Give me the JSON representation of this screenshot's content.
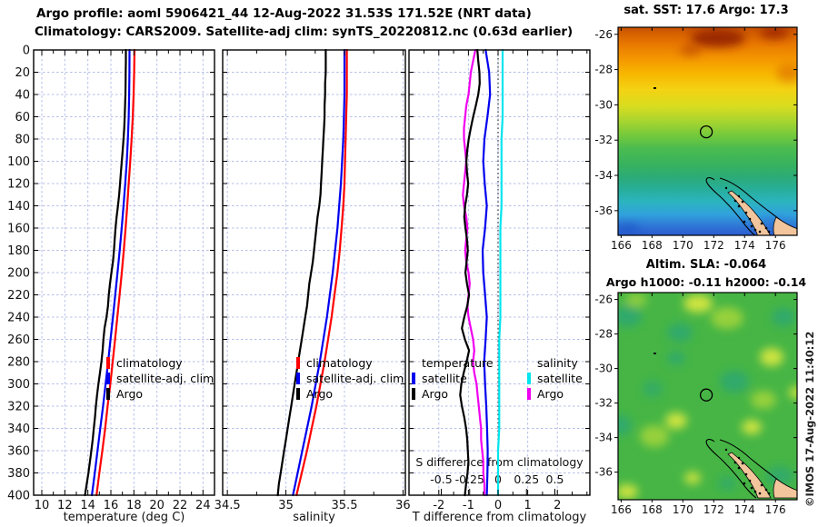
{
  "header": {
    "line1": "Argo profile: aoml 5906421_44 12-Aug-2022 31.53S 171.52E (NRT data)",
    "line2": "Climatology: CARS2009. Satellite-adj clim: synTS_20220812.nc (0.63d earlier)"
  },
  "watermark": "©IMOS 17-Aug-2022 11:40:12",
  "colors": {
    "climatology": "#ff0000",
    "satellite_adj_clim": "#0000ee",
    "argo": "#000000",
    "satellite_salinity": "#00e5ee",
    "argo_salinity": "#f000f0",
    "grid": "#b7bfe8",
    "land": "#f2c59c"
  },
  "legends": {
    "profile": [
      {
        "label": "climatology",
        "color": "#ff0000"
      },
      {
        "label": "satellite-adj. clim",
        "color": "#0000ee"
      },
      {
        "label": "Argo",
        "color": "#000000"
      }
    ],
    "difference": {
      "temperature": {
        "header": "temperature",
        "items": [
          {
            "label": "satellite",
            "color": "#0000ee"
          },
          {
            "label": "Argo",
            "color": "#000000"
          }
        ]
      },
      "salinity": {
        "header": "salinity",
        "items": [
          {
            "label": "satellite",
            "color": "#00e5ee"
          },
          {
            "label": "Argo",
            "color": "#f000f0"
          }
        ]
      }
    }
  },
  "chart_data": [
    {
      "id": "temperature-profile",
      "type": "line",
      "xlabel": "temperature (deg C)",
      "ylabel": "",
      "xlim": [
        9.29,
        25.0
      ],
      "ylim": [
        0,
        400
      ],
      "xticks": [
        10,
        12,
        14,
        16,
        18,
        20,
        22,
        24
      ],
      "xminor": 1,
      "ytick_step": 20,
      "grid": true,
      "series": [
        {
          "name": "climatology",
          "color": "#ff0000",
          "depth_step": 20,
          "values": [
            18.05,
            18.02,
            17.97,
            17.9,
            17.8,
            17.68,
            17.55,
            17.42,
            17.28,
            17.12,
            16.95,
            16.76,
            16.56,
            16.36,
            16.16,
            15.95,
            15.72,
            15.5,
            15.26,
            15.0,
            14.75
          ]
        },
        {
          "name": "satellite-adj. clim",
          "color": "#0000ee",
          "depth_step": 20,
          "values": [
            17.62,
            17.61,
            17.59,
            17.55,
            17.48,
            17.38,
            17.25,
            17.1,
            16.94,
            16.77,
            16.58,
            16.38,
            16.18,
            15.97,
            15.76,
            15.54,
            15.32,
            15.08,
            14.84,
            14.6,
            14.35
          ]
        },
        {
          "name": "Argo",
          "color": "#000000",
          "depth_step": 10,
          "values": [
            17.3,
            17.3,
            17.29,
            17.28,
            17.26,
            17.23,
            17.2,
            17.16,
            17.1,
            17.03,
            16.95,
            16.87,
            16.8,
            16.72,
            16.62,
            16.5,
            16.4,
            16.33,
            16.27,
            16.18,
            16.05,
            15.92,
            15.82,
            15.75,
            15.62,
            15.45,
            15.35,
            15.28,
            15.18,
            15.05,
            14.92,
            14.8,
            14.7,
            14.62,
            14.52,
            14.42,
            14.3,
            14.18,
            14.05,
            13.9,
            13.75
          ]
        }
      ]
    },
    {
      "id": "salinity-profile",
      "type": "line",
      "xlabel": "salinity",
      "ylabel": "",
      "xlim": [
        34.46,
        36.02
      ],
      "ylim": [
        0,
        400
      ],
      "xticks": [
        34.5,
        35,
        35.5,
        36
      ],
      "xminor": 0.25,
      "ytick_step": 20,
      "grid": true,
      "series": [
        {
          "name": "climatology",
          "color": "#ff0000",
          "depth_step": 20,
          "values": [
            35.52,
            35.52,
            35.52,
            35.515,
            35.51,
            35.505,
            35.5,
            35.49,
            35.475,
            35.46,
            35.44,
            35.415,
            35.39,
            35.36,
            35.33,
            35.295,
            35.26,
            35.22,
            35.18,
            35.135,
            35.09
          ]
        },
        {
          "name": "satellite-adj. clim",
          "color": "#0000ee",
          "depth_step": 20,
          "values": [
            35.5,
            35.5,
            35.5,
            35.495,
            35.49,
            35.48,
            35.47,
            35.455,
            35.44,
            35.42,
            35.4,
            35.375,
            35.35,
            35.32,
            35.29,
            35.255,
            35.22,
            35.18,
            35.14,
            35.1,
            35.06
          ]
        },
        {
          "name": "Argo",
          "color": "#000000",
          "depth_step": 10,
          "values": [
            35.34,
            35.34,
            35.34,
            35.335,
            35.335,
            35.33,
            35.33,
            35.325,
            35.32,
            35.315,
            35.31,
            35.305,
            35.3,
            35.295,
            35.285,
            35.27,
            35.26,
            35.25,
            35.24,
            35.23,
            35.215,
            35.2,
            35.19,
            35.18,
            35.165,
            35.15,
            35.135,
            35.12,
            35.105,
            35.09,
            35.075,
            35.06,
            35.045,
            35.03,
            35.015,
            35.0,
            34.985,
            34.97,
            34.955,
            34.94,
            34.93
          ]
        }
      ]
    },
    {
      "id": "difference-profile",
      "type": "line",
      "xlabel": "T difference from climatology",
      "xlabel2": "S difference from climatology",
      "ylabel": "",
      "xlim": [
        -3.006,
        3.098
      ],
      "xlim_s": [
        -0.784,
        0.808
      ],
      "ylim": [
        0,
        400
      ],
      "xticks": [
        -2,
        -1,
        0,
        1,
        2
      ],
      "xminor": 0.5,
      "xticks_s": [
        -0.5,
        -0.25,
        0,
        0.25,
        0.5
      ],
      "ytick_step": 20,
      "grid": true,
      "zero_line": true,
      "series": [
        {
          "name": "T satellite",
          "color": "#0000ee",
          "axis": "T",
          "depth_step": 20,
          "values": [
            -0.42,
            -0.3,
            -0.27,
            -0.36,
            -0.46,
            -0.5,
            -0.45,
            -0.38,
            -0.44,
            -0.52,
            -0.5,
            -0.44,
            -0.38,
            -0.42,
            -0.47,
            -0.44,
            -0.4,
            -0.37,
            -0.35,
            -0.36,
            -0.38
          ]
        },
        {
          "name": "S satellite",
          "color": "#00e5ee",
          "axis": "S",
          "depth_step": 20,
          "values": [
            0.04,
            0.04,
            0.04,
            0.04,
            0.03,
            0.03,
            0.03,
            0.03,
            0.02,
            0.02,
            0.02,
            0.02,
            0.02,
            0.01,
            0.01,
            0.01,
            0.01,
            0.01,
            0.0,
            0.0,
            0.0
          ]
        },
        {
          "name": "S Argo",
          "color": "#f000f0",
          "axis": "S",
          "depth_step": 10,
          "values": [
            -0.2,
            -0.22,
            -0.24,
            -0.25,
            -0.26,
            -0.28,
            -0.29,
            -0.3,
            -0.3,
            -0.29,
            -0.28,
            -0.29,
            -0.3,
            -0.31,
            -0.3,
            -0.28,
            -0.27,
            -0.28,
            -0.29,
            -0.28,
            -0.26,
            -0.25,
            -0.26,
            -0.27,
            -0.26,
            -0.24,
            -0.22,
            -0.21,
            -0.22,
            -0.21,
            -0.19,
            -0.18,
            -0.17,
            -0.16,
            -0.15,
            -0.15,
            -0.14,
            -0.13,
            -0.13,
            -0.12,
            -0.12
          ]
        },
        {
          "name": "T Argo",
          "color": "#000000",
          "axis": "T",
          "depth_step": 10,
          "values": [
            -0.7,
            -0.67,
            -0.63,
            -0.62,
            -0.67,
            -0.75,
            -0.84,
            -0.92,
            -0.99,
            -1.04,
            -1.07,
            -1.05,
            -1.01,
            -1.05,
            -1.11,
            -1.14,
            -1.1,
            -1.05,
            -1.02,
            -1.06,
            -1.1,
            -1.05,
            -0.98,
            -1.04,
            -1.14,
            -1.22,
            -1.12,
            -0.98,
            -1.06,
            -1.16,
            -1.24,
            -1.28,
            -1.22,
            -1.14,
            -1.08,
            -1.04,
            -1.02,
            -1.0,
            -1.03,
            -1.08,
            -1.12
          ]
        }
      ]
    }
  ],
  "maps": [
    {
      "id": "sst-map",
      "title": "sat. SST: 17.6 Argo: 17.3",
      "lon_ticks": [
        166,
        168,
        170,
        172,
        174,
        176
      ],
      "lat_ticks": [
        -26,
        -28,
        -30,
        -32,
        -34,
        -36
      ],
      "lon_range": [
        165.8,
        177.4
      ],
      "lat_range": [
        -25.6,
        -37.4
      ],
      "marker": {
        "lon": 171.52,
        "lat": -31.53
      }
    },
    {
      "id": "sla-map",
      "title_line1": "Altim. SLA: -0.064",
      "title_line2": "Argo h1000: -0.11 h2000: -0.14",
      "lon_ticks": [
        166,
        168,
        170,
        172,
        174,
        176
      ],
      "lat_ticks": [
        -26,
        -28,
        -30,
        -32,
        -34,
        -36
      ],
      "lon_range": [
        165.8,
        177.4
      ],
      "lat_range": [
        -25.6,
        -37.6
      ],
      "marker": {
        "lon": 171.52,
        "lat": -31.53
      }
    }
  ]
}
